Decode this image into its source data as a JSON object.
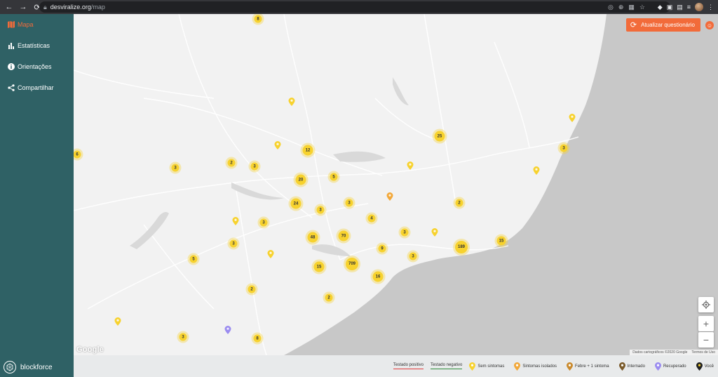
{
  "browser": {
    "url_host": "desviralize.org",
    "url_path": "/map"
  },
  "sidebar": {
    "items": [
      {
        "label": "Mapa",
        "icon": "map-icon",
        "active": true
      },
      {
        "label": "Estatísticas",
        "icon": "bar-chart-icon",
        "active": false
      },
      {
        "label": "Orientações",
        "icon": "info-icon",
        "active": false
      },
      {
        "label": "Compartilhar",
        "icon": "share-icon",
        "active": false
      }
    ],
    "brand": "blockforce"
  },
  "map": {
    "update_button": "Atualizar questionário",
    "google_logo": "Google",
    "attribution": "Dados cartográficos ©2020 Google",
    "terms": "Termos de Uso",
    "clusters": [
      {
        "value": "8"
      },
      {
        "value": "6"
      },
      {
        "value": "3"
      },
      {
        "value": "2"
      },
      {
        "value": "3"
      },
      {
        "value": "12"
      },
      {
        "value": "20"
      },
      {
        "value": "5"
      },
      {
        "value": "25"
      },
      {
        "value": "3"
      },
      {
        "value": "24"
      },
      {
        "value": "3"
      },
      {
        "value": "3"
      },
      {
        "value": "2"
      },
      {
        "value": "3"
      },
      {
        "value": "4"
      },
      {
        "value": "48"
      },
      {
        "value": "70"
      },
      {
        "value": "3"
      },
      {
        "value": "189"
      },
      {
        "value": "15"
      },
      {
        "value": "3"
      },
      {
        "value": "9"
      },
      {
        "value": "3"
      },
      {
        "value": "5"
      },
      {
        "value": "15"
      },
      {
        "value": "709"
      },
      {
        "value": "16"
      },
      {
        "value": "2"
      },
      {
        "value": "2"
      },
      {
        "value": "3"
      },
      {
        "value": "8"
      }
    ]
  },
  "legend": {
    "tested_positive": "Testado positivo",
    "tested_negative": "Testado negativo",
    "items": [
      {
        "label": "Sem sintomas",
        "color": "#f7d22e"
      },
      {
        "label": "Sintomas isolados",
        "color": "#f2a83a"
      },
      {
        "label": "Febre + 1 sintoma",
        "color": "#c98a2e"
      },
      {
        "label": "Internado",
        "color": "#7a5a2a"
      },
      {
        "label": "Recuperado",
        "color": "#9b8cf0"
      },
      {
        "label": "Você",
        "color": "#222222"
      }
    ]
  },
  "colors": {
    "sidebar_bg": "#2f6165",
    "accent": "#f26b3a",
    "cluster": "#f7d22e",
    "ocean": "#c8c8c8"
  }
}
